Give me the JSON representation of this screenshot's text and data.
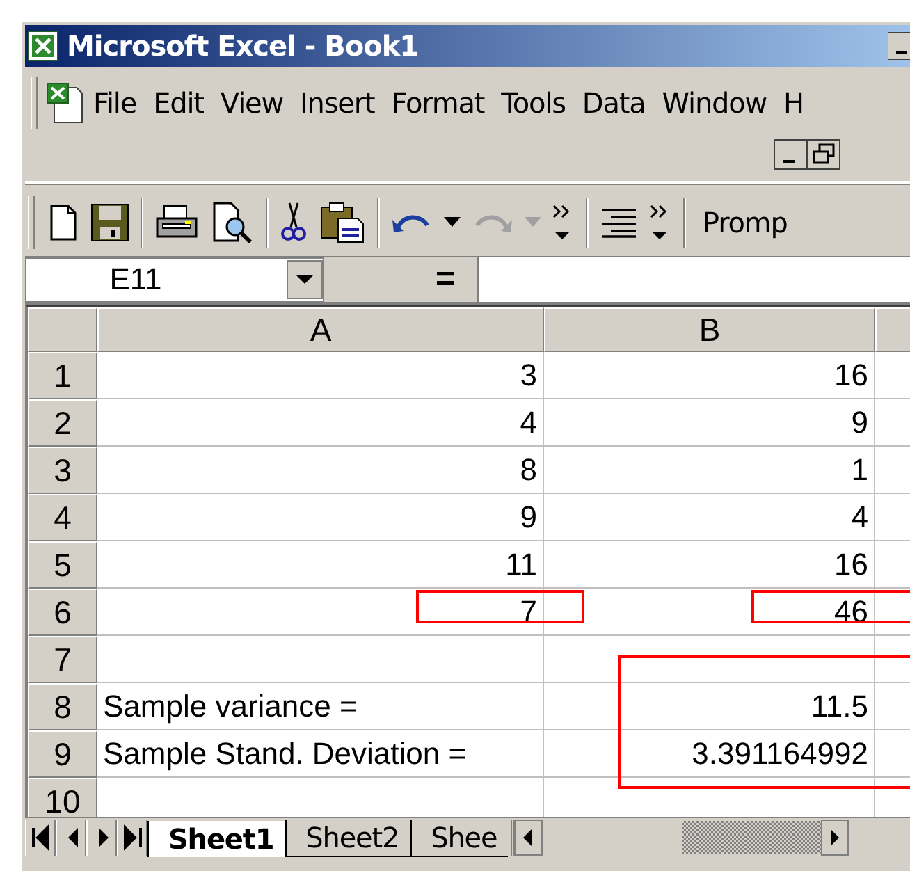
{
  "window": {
    "title": "Microsoft Excel - Book1"
  },
  "menu": [
    "File",
    "Edit",
    "View",
    "Insert",
    "Format",
    "Tools",
    "Data",
    "Window",
    "H"
  ],
  "toolbar": {
    "font_box": "Promp"
  },
  "formula_bar": {
    "name_box": "E11",
    "equals": "="
  },
  "columns": [
    "A",
    "B"
  ],
  "rows": [
    {
      "header": "1",
      "cells": [
        {
          "text": "3",
          "kind": "number",
          "marked": false
        },
        {
          "text": "16",
          "kind": "number",
          "marked": false
        }
      ]
    },
    {
      "header": "2",
      "cells": [
        {
          "text": "4",
          "kind": "number",
          "marked": false
        },
        {
          "text": "9",
          "kind": "number",
          "marked": false
        }
      ]
    },
    {
      "header": "3",
      "cells": [
        {
          "text": "8",
          "kind": "number",
          "marked": false
        },
        {
          "text": "1",
          "kind": "number",
          "marked": false
        }
      ]
    },
    {
      "header": "4",
      "cells": [
        {
          "text": "9",
          "kind": "number",
          "marked": false
        },
        {
          "text": "4",
          "kind": "number",
          "marked": false
        }
      ]
    },
    {
      "header": "5",
      "cells": [
        {
          "text": "11",
          "kind": "number",
          "marked": false
        },
        {
          "text": "16",
          "kind": "number",
          "marked": false
        }
      ]
    },
    {
      "header": "6",
      "cells": [
        {
          "text": "7",
          "kind": "number",
          "marked": true
        },
        {
          "text": "46",
          "kind": "number",
          "marked": true
        }
      ]
    },
    {
      "header": "7",
      "cells": []
    },
    {
      "header": "8",
      "cells": [
        {
          "text": "Sample variance =",
          "kind": "label",
          "marked": false
        },
        {
          "text": "11.5",
          "kind": "number",
          "marked": true
        }
      ]
    },
    {
      "header": "9",
      "cells": [
        {
          "text": "Sample Stand. Deviation =",
          "kind": "label",
          "marked": false
        },
        {
          "text": "3.391164992",
          "kind": "number",
          "marked": true
        }
      ]
    },
    {
      "header": "10",
      "cells": []
    }
  ],
  "sheet_tabs": [
    {
      "label": "Sheet1",
      "selected": true
    },
    {
      "label": "Sheet2",
      "selected": false
    },
    {
      "label": "Shee",
      "selected": false
    }
  ]
}
